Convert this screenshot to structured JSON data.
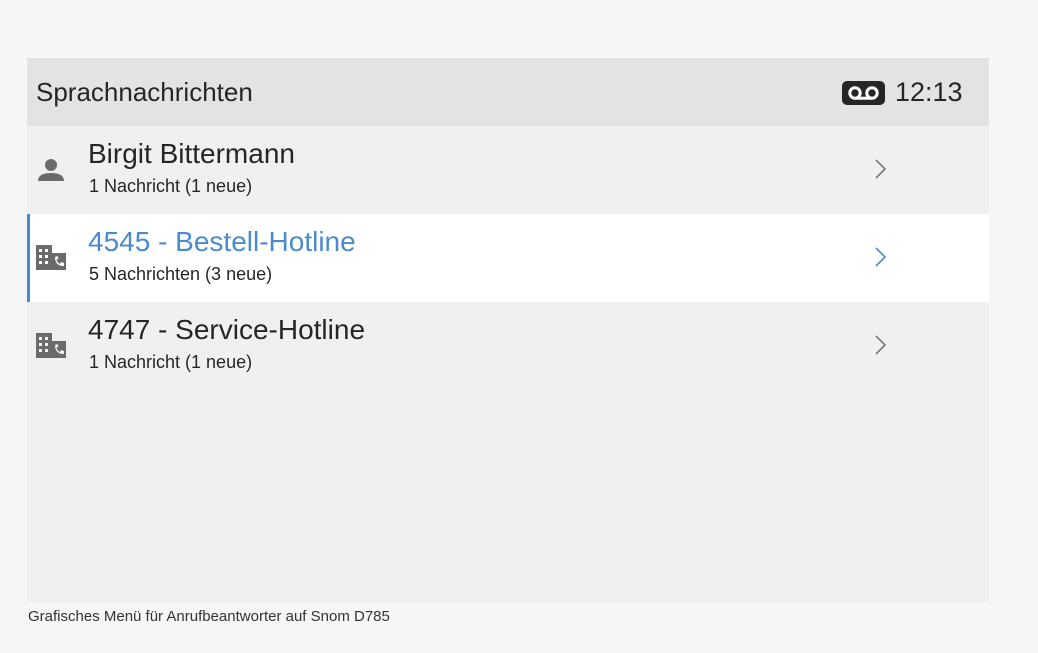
{
  "header": {
    "title": "Sprachnachrichten",
    "status_icon": "voicemail-icon",
    "time": "12:13"
  },
  "items": [
    {
      "title": "Birgit Bittermann",
      "subtitle": "1 Nachricht (1 neue)",
      "icon": "person-icon",
      "selected": false
    },
    {
      "title": "4545 - Bestell-Hotline",
      "subtitle": "5 Nachrichten (3 neue)",
      "icon": "building-phone-icon",
      "selected": true
    },
    {
      "title": "4747 - Service-Hotline",
      "subtitle": "1 Nachricht (1 neue)",
      "icon": "building-phone-icon",
      "selected": false
    }
  ],
  "caption": "Grafisches Menü für Anrufbeantworter auf Snom D785",
  "colors": {
    "accent": "#4a8bd0",
    "header_bg": "#e3e3e3",
    "list_bg": "#f0f0f0",
    "selected_bg": "#ffffff",
    "icon": "#6b6b6b",
    "text": "#262626"
  }
}
